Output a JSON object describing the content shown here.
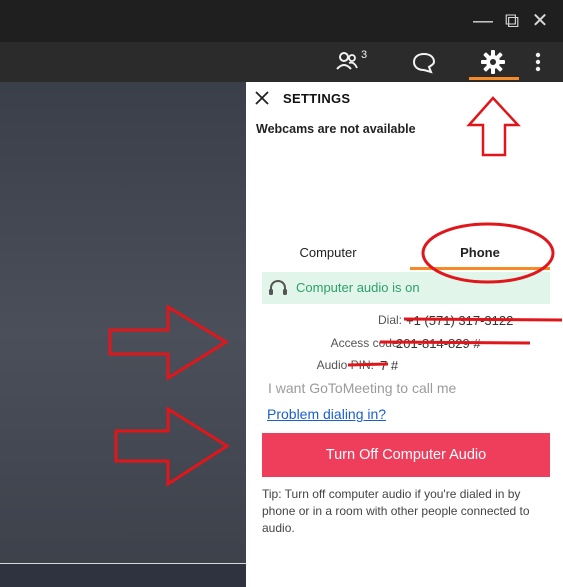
{
  "window": {
    "minimize_glyph": "—",
    "restore_glyph": "⧉",
    "close_glyph": "✕"
  },
  "toolbar": {
    "people_count": "3",
    "icons": [
      "people-icon",
      "chat-icon",
      "gear-icon",
      "more-vertical-icon"
    ],
    "active_accent": "#f58a27"
  },
  "settings": {
    "close_glyph": "✕",
    "title": "SETTINGS",
    "webcam_message": "Webcams are not available",
    "tabs": [
      {
        "label": "Computer",
        "active": false
      },
      {
        "label": "Phone",
        "active": true
      }
    ],
    "audio_status": "Computer audio is on",
    "dial": {
      "dial_label": "Dial:",
      "dial_value": "+1 (571) 317-3122",
      "access_label": "Access code:",
      "access_value": "201-814-829 #",
      "pin_label": "Audio PIN:",
      "pin_value": "7 #"
    },
    "call_me": "I want GoToMeeting to call me",
    "problem_link": "Problem dialing in?",
    "turn_off_label": "Turn Off Computer Audio",
    "tip": "Tip: Turn off computer audio if you're dialed in by phone or in a room with other people connected to audio."
  },
  "colors": {
    "accent_orange": "#f58a27",
    "button_red": "#ef3e5c",
    "status_green_bg": "#e2f5ea",
    "status_green_text": "#2f9e6a",
    "link_blue": "#1a5fd0",
    "annotation_red": "#e0161b"
  }
}
